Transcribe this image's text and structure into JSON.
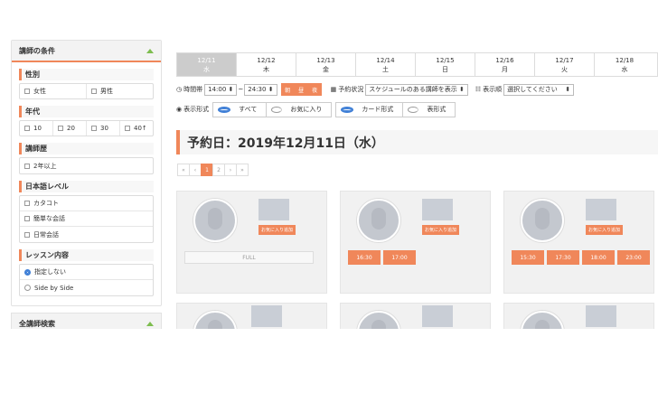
{
  "sidebar": {
    "panel_title": "講師の条件",
    "gender": {
      "label": "性別",
      "options": [
        "女性",
        "男性"
      ]
    },
    "age": {
      "label": "年代",
      "options": [
        "10",
        "20",
        "30",
        "40↑"
      ]
    },
    "career": {
      "label": "講師歴",
      "options": [
        "2年以上"
      ]
    },
    "jp_level": {
      "label": "日本語レベル",
      "options": [
        "カタコト",
        "簡単な会話",
        "日常会話"
      ]
    },
    "lesson": {
      "label": "レッスン内容",
      "options": [
        "指定しない",
        "Side by Side"
      ],
      "selected": "指定しない"
    },
    "panel2_title": "全講師検索"
  },
  "main": {
    "dates": [
      {
        "date": "12/11",
        "day": "水",
        "selected": true
      },
      {
        "date": "12/12",
        "day": "木"
      },
      {
        "date": "12/13",
        "day": "金"
      },
      {
        "date": "12/14",
        "day": "土"
      },
      {
        "date": "12/15",
        "day": "日"
      },
      {
        "date": "12/16",
        "day": "月"
      },
      {
        "date": "12/17",
        "day": "火"
      },
      {
        "date": "12/18",
        "day": "水"
      }
    ],
    "time": {
      "label": "時間帯",
      "start": "14:00",
      "sep": "~",
      "end": "24:30",
      "buttons": [
        "朝",
        "昼",
        "夜"
      ]
    },
    "status": {
      "label": "予約状況",
      "value": "スケジュールのある講師を表示"
    },
    "sort": {
      "label": "表示順",
      "value": "選択してください"
    },
    "display": {
      "label": "表示形式",
      "filter": [
        "すべて",
        "お気に入り"
      ],
      "format": [
        "カード形式",
        "表形式"
      ]
    },
    "heading": "予約日：2019年12月11日（水）",
    "pager": [
      "«",
      "‹",
      "1",
      "2",
      "›",
      "»"
    ],
    "fav_label": "お気に入り追加",
    "full_label": "FULL",
    "cards": [
      {
        "slots": []
      },
      {
        "slots": [
          "16:30",
          "17:00"
        ]
      },
      {
        "slots": [
          "15:30",
          "17:30",
          "18:00",
          "23:00"
        ]
      }
    ]
  }
}
